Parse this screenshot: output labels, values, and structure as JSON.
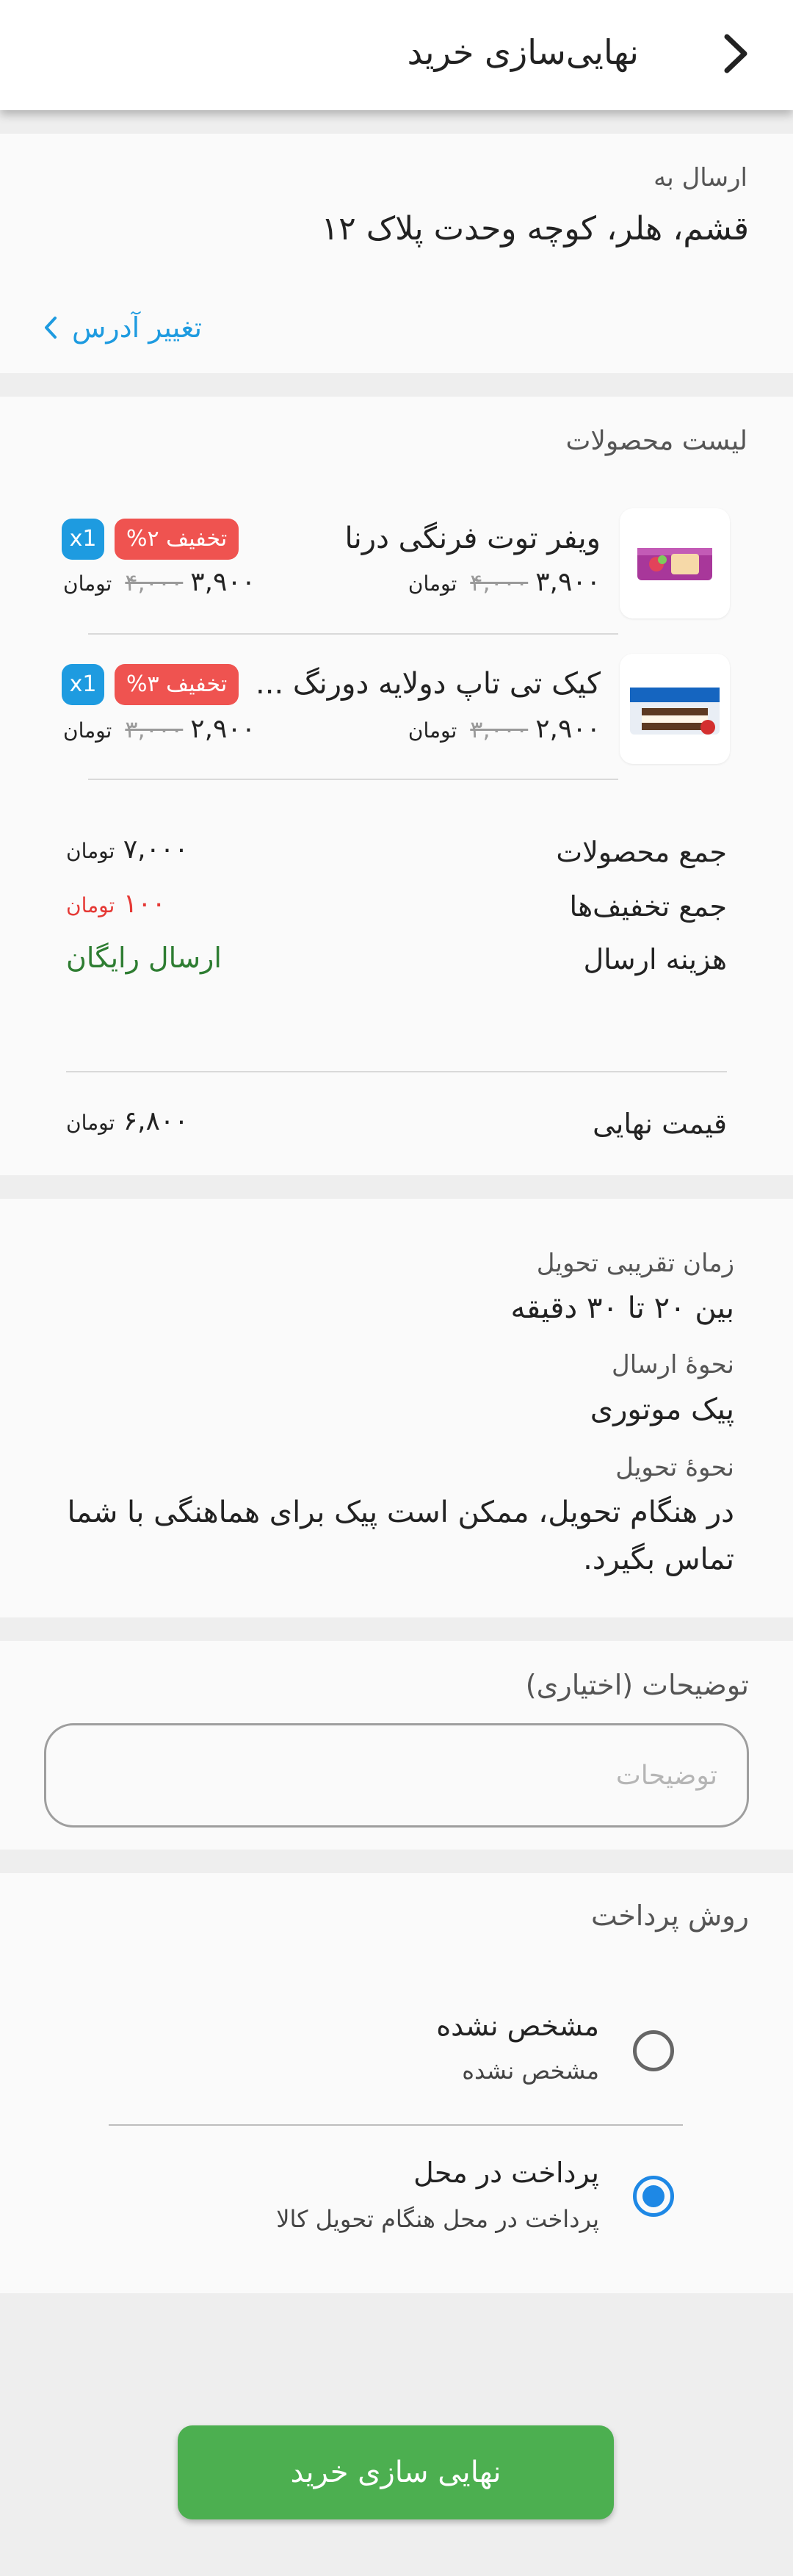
{
  "header": {
    "title": "نهایی‌سازی خرید"
  },
  "address": {
    "label": "ارسال به",
    "value": "قشم، هلر، کوچه وحدت پلاک ۱۲",
    "change_link": "تغییر آدرس"
  },
  "products": {
    "title": "لیست محصولات",
    "items": [
      {
        "name": "ویفر توت فرنگی درنا",
        "old_price": "۴,۰۰۰",
        "price": "۳,۹۰۰",
        "currency": "تومان",
        "discount": "تخفیف ۲%",
        "qty": "x1"
      },
      {
        "name": "کیک تی تاپ دولایه دورنگ ...",
        "old_price": "۳,۰۰۰",
        "price": "۲,۹۰۰",
        "currency": "تومان",
        "discount": "تخفیف ۳%",
        "qty": "x1"
      }
    ]
  },
  "summary": {
    "subtotal_label": "جمع محصولات",
    "subtotal_value": "۷,۰۰۰",
    "discount_label": "جمع تخفیف‌ها",
    "discount_value": "۱۰۰",
    "shipping_label": "هزینه ارسال",
    "shipping_value": "ارسال رایگان",
    "total_label": "قیمت نهایی",
    "total_value": "۶,۸۰۰",
    "currency": "تومان"
  },
  "delivery": {
    "time_label": "زمان تقریبی تحویل",
    "time_value": "بین ۲۰ تا ۳۰ دقیقه",
    "method_label": "نحوهٔ ارسال",
    "method_value": "پیک موتوری",
    "handover_label": "نحوهٔ تحویل",
    "handover_line1": "در هنگام تحویل، ممکن است پیک برای هماهنگی با شما",
    "handover_line2": "تماس بگیرد."
  },
  "notes": {
    "label": "توضیحات (اختیاری)",
    "placeholder": "توضیحات",
    "value": ""
  },
  "payment": {
    "title": "روش پرداخت",
    "options": [
      {
        "title": "مشخص نشده",
        "subtitle": "مشخص نشده",
        "selected": false
      },
      {
        "title": "پرداخت در محل",
        "subtitle": "پرداخت در محل هنگام تحویل کالا",
        "selected": true
      }
    ]
  },
  "submit_label": "نهایی سازی خرید",
  "colors": {
    "accent_blue": "#1e9be0",
    "discount_red": "#ef5350",
    "free_green": "#2e7d32",
    "primary_button": "#4caf50"
  }
}
